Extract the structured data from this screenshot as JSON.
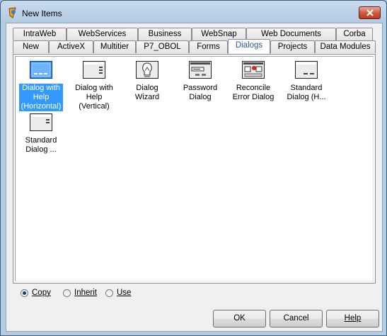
{
  "window": {
    "title": "New Items"
  },
  "tabs_row1": [
    {
      "label": "IntraWeb"
    },
    {
      "label": "WebServices"
    },
    {
      "label": "Business"
    },
    {
      "label": "WebSnap"
    },
    {
      "label": "Web Documents"
    },
    {
      "label": "Corba"
    }
  ],
  "tabs_row2": [
    {
      "label": "New"
    },
    {
      "label": "ActiveX"
    },
    {
      "label": "Multitier"
    },
    {
      "label": "P7_OBOL"
    },
    {
      "label": "Forms"
    },
    {
      "label": "Dialogs",
      "active": true
    },
    {
      "label": "Projects"
    },
    {
      "label": "Data Modules"
    }
  ],
  "items": [
    {
      "label": "Dialog with Help (Horizontal)",
      "icon": "dialog-help-horizontal-icon",
      "selected": true
    },
    {
      "label": "Dialog with Help (Vertical)",
      "icon": "dialog-help-vertical-icon"
    },
    {
      "label": "Dialog Wizard",
      "icon": "lightbulb-icon"
    },
    {
      "label": "Password Dialog",
      "icon": "password-dialog-icon"
    },
    {
      "label": "Reconcile Error Dialog",
      "icon": "reconcile-error-icon"
    },
    {
      "label": "Standard Dialog (H...",
      "icon": "standard-dialog-h-icon"
    },
    {
      "label": "Standard Dialog ...",
      "icon": "standard-dialog-icon"
    }
  ],
  "options": [
    {
      "label": "Copy",
      "selected": true
    },
    {
      "label": "Inherit",
      "selected": false
    },
    {
      "label": "Use",
      "selected": false
    }
  ],
  "buttons": {
    "ok": "OK",
    "cancel": "Cancel",
    "help": "Help"
  },
  "colors": {
    "selection": "#3399ff",
    "active_tab_text": "#2a56a4",
    "close_button": "#c0391f"
  }
}
